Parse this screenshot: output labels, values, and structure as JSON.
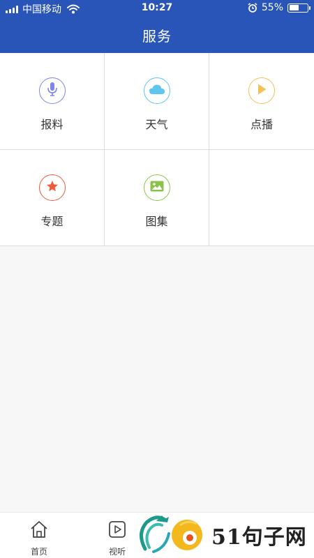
{
  "status_bar": {
    "carrier": "中国移动",
    "time": "10:27",
    "battery_percent": "55%",
    "battery_level": 0.55,
    "icons": [
      "signal-icon",
      "wifi-icon",
      "alarm-icon",
      "battery-icon"
    ]
  },
  "header": {
    "title": "服务"
  },
  "services": [
    {
      "label": "报料",
      "icon": "microphone-icon",
      "color": "#7d86e6"
    },
    {
      "label": "天气",
      "icon": "cloud-icon",
      "color": "#5fc5ee"
    },
    {
      "label": "点播",
      "icon": "play-icon",
      "color": "#f3c15a"
    },
    {
      "label": "专题",
      "icon": "star-icon",
      "color": "#ee5a3c"
    },
    {
      "label": "图集",
      "icon": "image-icon",
      "color": "#8bc34a"
    }
  ],
  "tabbar": {
    "items": [
      {
        "label": "首页",
        "icon": "home-icon"
      },
      {
        "label": "视听",
        "icon": "video-icon"
      }
    ]
  },
  "watermark": {
    "text": "51句子网"
  }
}
